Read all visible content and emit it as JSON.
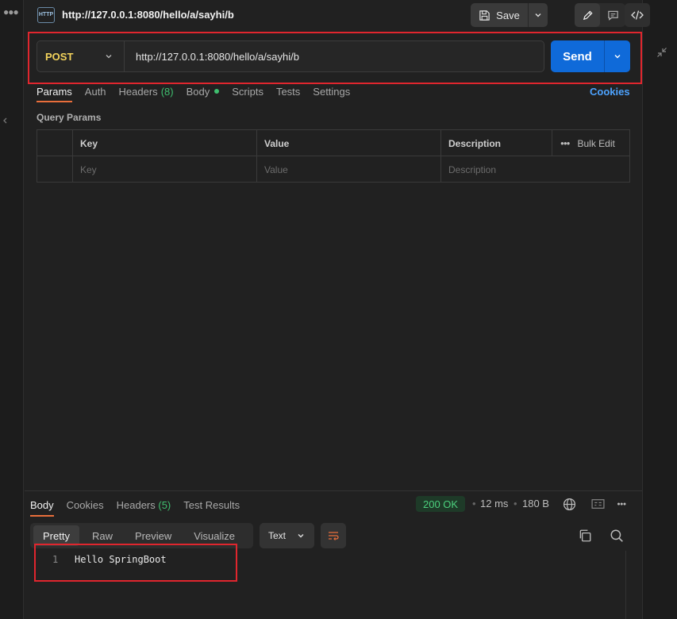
{
  "tab": {
    "title": "http://127.0.0.1:8080/hello/a/sayhi/b",
    "icon_label": "HTTP"
  },
  "toolbar": {
    "save_label": "Save"
  },
  "request": {
    "method": "POST",
    "url": "http://127.0.0.1:8080/hello/a/sayhi/b",
    "send_label": "Send"
  },
  "request_tabs": {
    "params": "Params",
    "auth": "Auth",
    "headers": "Headers",
    "headers_count": "(8)",
    "body": "Body",
    "scripts": "Scripts",
    "tests": "Tests",
    "settings": "Settings",
    "cookies": "Cookies"
  },
  "query_params": {
    "label": "Query Params",
    "columns": {
      "key": "Key",
      "value": "Value",
      "description": "Description",
      "bulk_edit": "Bulk Edit"
    },
    "placeholders": {
      "key": "Key",
      "value": "Value",
      "description": "Description"
    }
  },
  "response": {
    "tabs": {
      "body": "Body",
      "cookies": "Cookies",
      "headers": "Headers",
      "headers_count": "(5)",
      "test_results": "Test Results"
    },
    "status": "200 OK",
    "time": "12 ms",
    "size": "180 B",
    "views": {
      "pretty": "Pretty",
      "raw": "Raw",
      "preview": "Preview",
      "visualize": "Visualize"
    },
    "format": "Text",
    "lines": [
      {
        "num": "1",
        "text": "Hello SpringBoot"
      }
    ]
  },
  "colors": {
    "accent_orange": "#e96e3b",
    "send_blue": "#0f6ad9",
    "method_yellow": "#f3d35c",
    "status_green": "#4cd07d",
    "highlight_red": "#e0262e"
  },
  "icons": {
    "save": "save-icon",
    "edit": "pencil-icon",
    "comment": "comment-icon",
    "code": "code-icon",
    "globe": "globe-icon",
    "copy": "copy-icon",
    "search": "search-icon",
    "wrap": "wrap-lines-icon"
  }
}
